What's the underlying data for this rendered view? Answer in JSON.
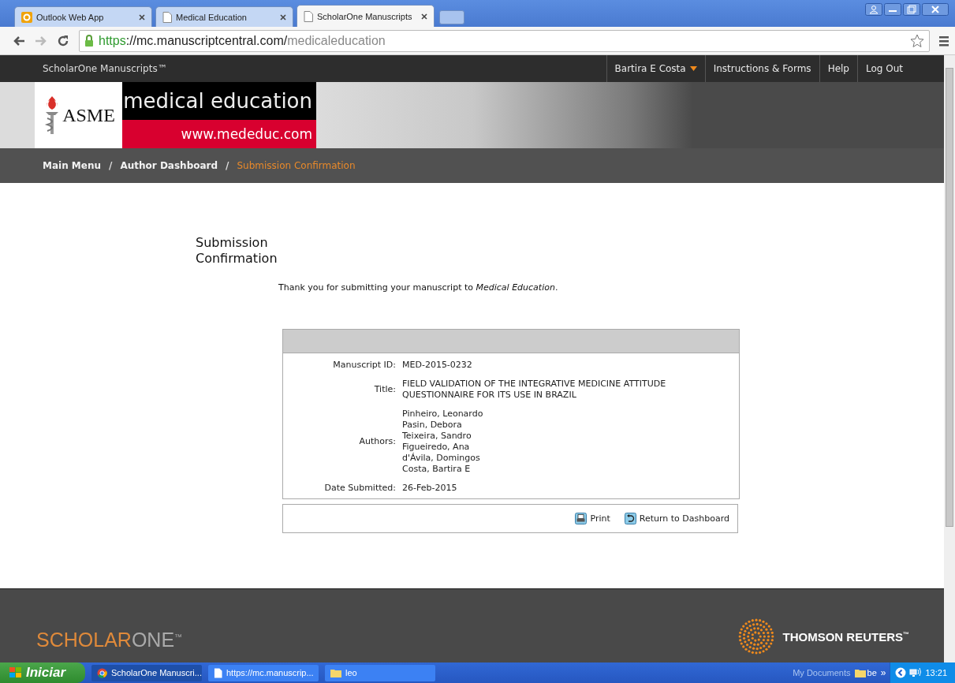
{
  "browser": {
    "tabs": [
      {
        "label": "Outlook Web App",
        "kind": "outlook",
        "selected": false
      },
      {
        "label": "Medical Education",
        "kind": "page",
        "selected": false
      },
      {
        "label": "ScholarOne Manuscripts",
        "kind": "page",
        "selected": true
      }
    ],
    "url": {
      "scheme": "https",
      "host": "://mc.manuscriptcentral.com/",
      "path": "medicaleducation"
    }
  },
  "site_header": {
    "brand": "ScholarOne Manuscripts™",
    "nav": [
      {
        "label": "Bartira E Costa",
        "dropdown": true
      },
      {
        "label": "Instructions & Forms",
        "dropdown": false
      },
      {
        "label": "Help",
        "dropdown": false
      },
      {
        "label": "Log Out",
        "dropdown": false
      }
    ]
  },
  "banner": {
    "society": "ASME",
    "journal": "medical education",
    "website": "www.mededuc.com"
  },
  "breadcrumb": [
    {
      "label": "Main Menu",
      "current": false
    },
    {
      "separator": "/",
      "label": "Author Dashboard",
      "current": false
    },
    {
      "separator": "/",
      "label": "Submission Confirmation",
      "current": true
    }
  ],
  "page_title": "Submission Confirmation",
  "message": "Thank you for submitting your manuscript to *Medical Education*.",
  "details": [
    {
      "label": "Manuscript ID:",
      "lines": [
        "MED-2015-0232"
      ]
    },
    {
      "label": "Title:",
      "lines": [
        "FIELD VALIDATION OF THE INTEGRATIVE MEDICINE ATTITUDE",
        "QUESTIONNAIRE FOR ITS USE IN BRAZIL"
      ]
    },
    {
      "label": "Authors:",
      "lines": [
        "Pinheiro, Leonardo",
        "Pasin, Debora",
        "Teixeira, Sandro",
        "Figueiredo, Ana",
        "d'Ávila, Domingos",
        "Costa, Bartira E"
      ]
    },
    {
      "label": "Date Submitted:",
      "lines": [
        "26-Feb-2015"
      ]
    }
  ],
  "actions": [
    {
      "label": "Print",
      "kind": "print"
    },
    {
      "label": "Return to Dashboard",
      "kind": "return"
    }
  ],
  "footer": {
    "logo_bold": "SCHOLAR",
    "logo_light": "ONE",
    "logo_mark": "™",
    "partner": "THOMSON REUTERS",
    "partner_mark": "™"
  },
  "taskbar": {
    "start": "Iniciar",
    "items": [
      {
        "label": "ScholarOne Manuscri...",
        "kind": "browser",
        "selected": true
      },
      {
        "label": "https://mc.manuscrip...",
        "kind": "page",
        "selected": false
      },
      {
        "label": "leo",
        "kind": "folder",
        "selected": false
      }
    ],
    "tray_label": "My Documents",
    "tray_folder": "be",
    "tray_more": "»",
    "time": "13:21"
  }
}
